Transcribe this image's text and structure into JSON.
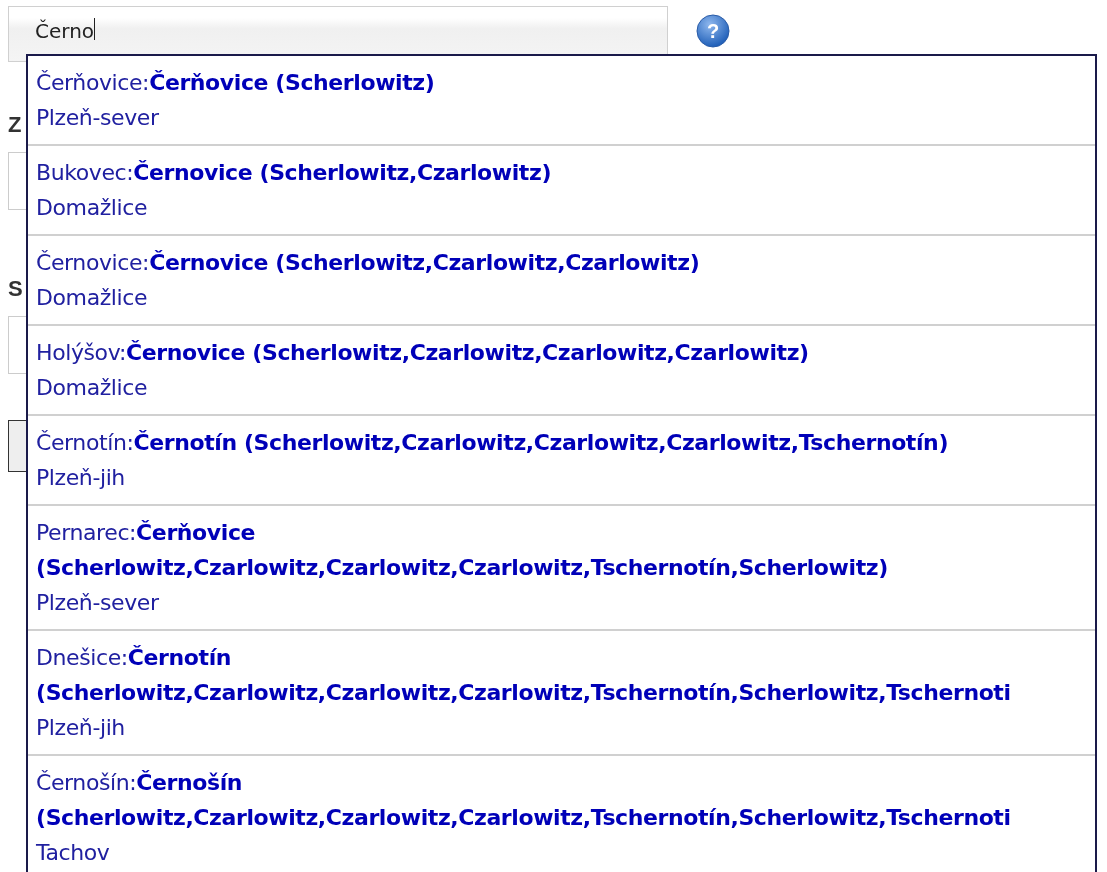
{
  "search": {
    "value": "Černo"
  },
  "help": {
    "glyph": "?"
  },
  "form_labels": [
    "Z",
    "S"
  ],
  "suggestions": [
    {
      "title": "Čerňovice:**Čerňovice (Scherlowitz)**",
      "district": "Plzeň-sever"
    },
    {
      "title": "Bukovec:**Černovice (Scherlowitz,Czarlowitz)**",
      "district": "Domažlice"
    },
    {
      "title": "Černovice:**Černovice (Scherlowitz,Czarlowitz,Czarlowitz)**",
      "district": "Domažlice"
    },
    {
      "title": "Holýšov:**Černovice (Scherlowitz,Czarlowitz,Czarlowitz,Czarlowitz)**",
      "district": "Domažlice"
    },
    {
      "title": "Černotín:**Černotín (Scherlowitz,Czarlowitz,Czarlowitz,Czarlowitz,Tschernotín)**",
      "district": "Plzeň-jih"
    },
    {
      "title": "Pernarec:**Čerňovice (Scherlowitz,Czarlowitz,Czarlowitz,Czarlowitz,Tschernotín,Scherlowitz)**",
      "district": "Plzeň-sever"
    },
    {
      "title": "Dnešice:**Černotín (Scherlowitz,Czarlowitz,Czarlowitz,Czarlowitz,Tschernotín,Scherlowitz,Tschernoti**",
      "district": "Plzeň-jih"
    },
    {
      "title": "Černošín:**Černošín (Scherlowitz,Czarlowitz,Czarlowitz,Czarlowitz,Tschernotín,Scherlowitz,Tschernoti**",
      "district": "Tachov"
    }
  ]
}
